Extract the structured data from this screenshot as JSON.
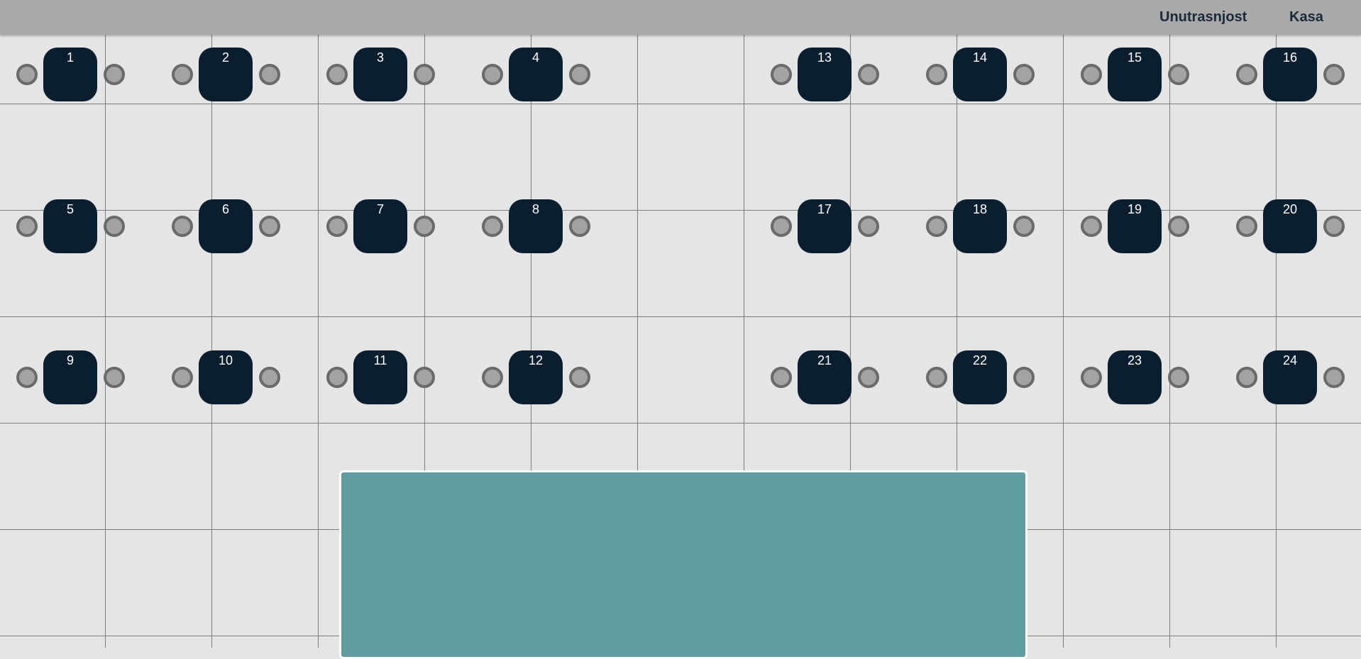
{
  "nav": {
    "items": [
      "Unutrasnjost",
      "Kasa"
    ]
  },
  "colors": {
    "topbar": "#a9a9a9",
    "background": "#e5e5e5",
    "table": "#0b1e2f",
    "chair_fill": "#a3a3a3",
    "chair_border": "#6a6a6a",
    "bar_counter": "#609ca0",
    "grid_line": "#7d7d7d"
  },
  "tables": [
    {
      "number": "1"
    },
    {
      "number": "2"
    },
    {
      "number": "3"
    },
    {
      "number": "4"
    },
    {
      "number": "5"
    },
    {
      "number": "6"
    },
    {
      "number": "7"
    },
    {
      "number": "8"
    },
    {
      "number": "9"
    },
    {
      "number": "10"
    },
    {
      "number": "11"
    },
    {
      "number": "12"
    },
    {
      "number": "13"
    },
    {
      "number": "14"
    },
    {
      "number": "15"
    },
    {
      "number": "16"
    },
    {
      "number": "17"
    },
    {
      "number": "18"
    },
    {
      "number": "19"
    },
    {
      "number": "20"
    },
    {
      "number": "21"
    },
    {
      "number": "22"
    },
    {
      "number": "23"
    },
    {
      "number": "24"
    }
  ]
}
